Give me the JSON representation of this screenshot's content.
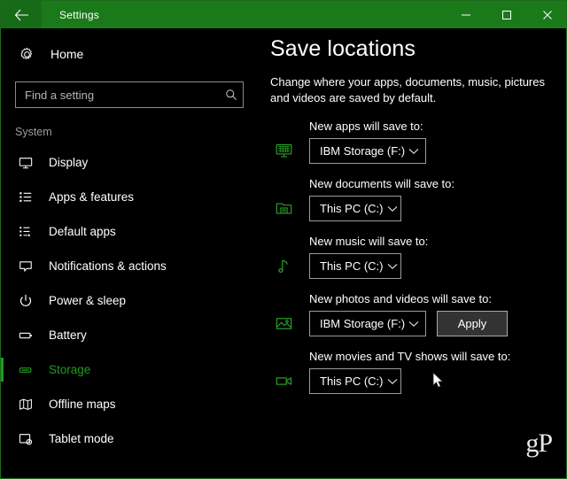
{
  "window": {
    "title": "Settings",
    "back_icon": "back-arrow-icon",
    "controls": {
      "minimize": "minimize-icon",
      "maximize": "maximize-icon",
      "close": "close-icon"
    },
    "accent_color": "#1a7a1a",
    "titlebar_color": "#1a7a1a",
    "background_color": "#000000"
  },
  "sidebar": {
    "home": {
      "label": "Home",
      "icon": "gear-icon"
    },
    "search": {
      "placeholder": "Find a setting",
      "value": "",
      "icon": "search-icon"
    },
    "section_title": "System",
    "selected_color": "#1f9b1f",
    "items": [
      {
        "label": "Display",
        "icon": "monitor-icon",
        "selected": false
      },
      {
        "label": "Apps & features",
        "icon": "list-icon",
        "selected": false
      },
      {
        "label": "Default apps",
        "icon": "list-arrow-icon",
        "selected": false
      },
      {
        "label": "Notifications & actions",
        "icon": "speech-bubble-icon",
        "selected": false
      },
      {
        "label": "Power & sleep",
        "icon": "power-icon",
        "selected": false
      },
      {
        "label": "Battery",
        "icon": "battery-icon",
        "selected": false
      },
      {
        "label": "Storage",
        "icon": "storage-icon",
        "selected": true
      },
      {
        "label": "Offline maps",
        "icon": "map-icon",
        "selected": false
      },
      {
        "label": "Tablet mode",
        "icon": "tablet-icon",
        "selected": false
      }
    ]
  },
  "main": {
    "title": "Save locations",
    "description": "Change where your apps, documents, music, pictures and videos are saved by default.",
    "icon_color": "#2aa02a",
    "groups": [
      {
        "label": "New apps will save to:",
        "icon": "store-app-icon",
        "value": "IBM Storage (F:)",
        "width": "wide",
        "has_apply": false
      },
      {
        "label": "New documents will save to:",
        "icon": "documents-folder-icon",
        "value": "This PC (C:)",
        "width": "narrow",
        "has_apply": false
      },
      {
        "label": "New music will save to:",
        "icon": "music-note-icon",
        "value": "This PC (C:)",
        "width": "narrow",
        "has_apply": false
      },
      {
        "label": "New photos and videos will save to:",
        "icon": "picture-icon",
        "value": "IBM Storage (F:)",
        "width": "wide",
        "has_apply": true
      },
      {
        "label": "New movies and TV shows will save to:",
        "icon": "video-camera-icon",
        "value": "This PC (C:)",
        "width": "narrow",
        "has_apply": false
      }
    ],
    "apply_label": "Apply",
    "dropdown_chevron": "chevron-down-icon"
  },
  "watermark": {
    "text": "gP"
  },
  "cursor": {
    "icon": "mouse-pointer-icon"
  }
}
